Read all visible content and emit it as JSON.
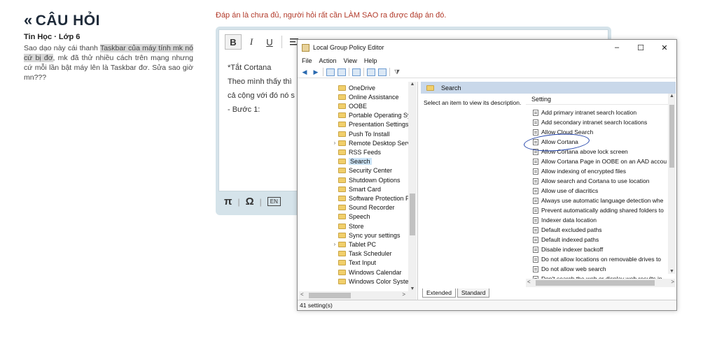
{
  "header": {
    "title": "CÂU HỎI",
    "back_glyph": "«"
  },
  "question": {
    "subject": "Tin Học · Lớp 6",
    "text_pre": "Sao dạo này cái thanh ",
    "text_hl": "Taskbar của máy tính mk nó cứ bị đơ",
    "text_post": ", mk đã thử nhiều cách trên mạng nhưng cứ mỗi lần bật máy lên là Taskbar đơ. Sửa sao giờ mn???"
  },
  "notice": "Đáp án là chưa đủ, người hỏi rất cần LÀM SAO ra được đáp án đó.",
  "editor": {
    "toolbar": {
      "bold": "B",
      "italic": "I",
      "underline": "U"
    },
    "lines": [
      "*Tắt Cortana",
      "Theo mình thấy thì",
      "cả cộng với đó nó s",
      "- Bước 1:"
    ],
    "bottom": {
      "pi": "π",
      "omega": "Ω",
      "kbd": "EN"
    }
  },
  "window": {
    "title": "Local Group Policy Editor",
    "controls": {
      "minimize": "–",
      "maximize": "☐",
      "close": "✕"
    },
    "menu": [
      "File",
      "Action",
      "View",
      "Help"
    ],
    "tree": [
      {
        "label": "OneDrive",
        "expandable": false
      },
      {
        "label": "Online Assistance",
        "expandable": false
      },
      {
        "label": "OOBE",
        "expandable": false
      },
      {
        "label": "Portable Operating Sy",
        "expandable": false
      },
      {
        "label": "Presentation Settings",
        "expandable": false
      },
      {
        "label": "Push To Install",
        "expandable": false
      },
      {
        "label": "Remote Desktop Serv",
        "expandable": true
      },
      {
        "label": "RSS Feeds",
        "expandable": false
      },
      {
        "label": "Search",
        "expandable": false,
        "selected": true
      },
      {
        "label": "Security Center",
        "expandable": false
      },
      {
        "label": "Shutdown Options",
        "expandable": false
      },
      {
        "label": "Smart Card",
        "expandable": false
      },
      {
        "label": "Software Protection P",
        "expandable": false
      },
      {
        "label": "Sound Recorder",
        "expandable": false
      },
      {
        "label": "Speech",
        "expandable": false
      },
      {
        "label": "Store",
        "expandable": false
      },
      {
        "label": "Sync your settings",
        "expandable": false
      },
      {
        "label": "Tablet PC",
        "expandable": true
      },
      {
        "label": "Task Scheduler",
        "expandable": false
      },
      {
        "label": "Text Input",
        "expandable": false
      },
      {
        "label": "Windows Calendar",
        "expandable": false
      },
      {
        "label": "Windows Color Syste",
        "expandable": false
      }
    ],
    "pane_header": "Search",
    "description": "Select an item to view its description.",
    "column_header": "Setting",
    "settings": [
      "Add primary intranet search location",
      "Add secondary intranet search locations",
      "Allow Cloud Search",
      "Allow Cortana",
      "Allow Cortana above lock screen",
      "Allow Cortana Page in OOBE on an AAD accou",
      "Allow indexing of encrypted files",
      "Allow search and Cortana to use location",
      "Allow use of diacritics",
      "Always use automatic language detection whe",
      "Prevent automatically adding shared folders to",
      "Indexer data location",
      "Default excluded paths",
      "Default indexed paths",
      "Disable indexer backoff",
      "Do not allow locations on removable drives to",
      "Do not allow web search",
      "Don't search the web or display web results in"
    ],
    "tabs": [
      "Extended",
      "Standard"
    ],
    "status": "41 setting(s)"
  }
}
